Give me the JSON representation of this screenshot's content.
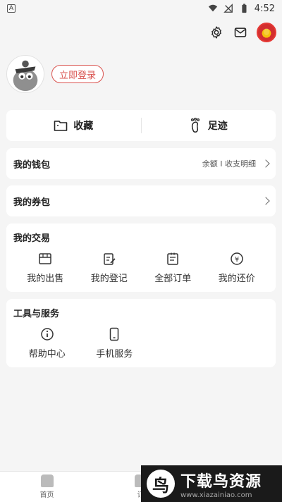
{
  "status_bar": {
    "time": "4:52",
    "app_badge": "A"
  },
  "profile": {
    "login_label": "立即登录"
  },
  "quick": {
    "favorites_label": "收藏",
    "footprints_label": "足迹"
  },
  "wallet": {
    "title": "我的钱包",
    "detail": "余额 I 收支明细"
  },
  "coupon": {
    "title": "我的券包"
  },
  "trade": {
    "title": "我的交易",
    "items": [
      {
        "label": "我的出售",
        "icon": "store-icon"
      },
      {
        "label": "我的登记",
        "icon": "register-icon"
      },
      {
        "label": "全部订单",
        "icon": "orders-icon"
      },
      {
        "label": "我的还价",
        "icon": "yen-icon"
      }
    ]
  },
  "tools": {
    "title": "工具与服务",
    "items": [
      {
        "label": "帮助中心",
        "icon": "info-icon"
      },
      {
        "label": "手机服务",
        "icon": "phone-icon"
      }
    ]
  },
  "bottom_nav": {
    "items": [
      {
        "label": "首页"
      },
      {
        "label": "订"
      }
    ]
  },
  "watermark": {
    "title": "下载鸟资源",
    "url": "www.xiazainiao.com",
    "logo": "鸟"
  },
  "colors": {
    "accent": "#d9534f",
    "background": "#f5f5f5"
  }
}
